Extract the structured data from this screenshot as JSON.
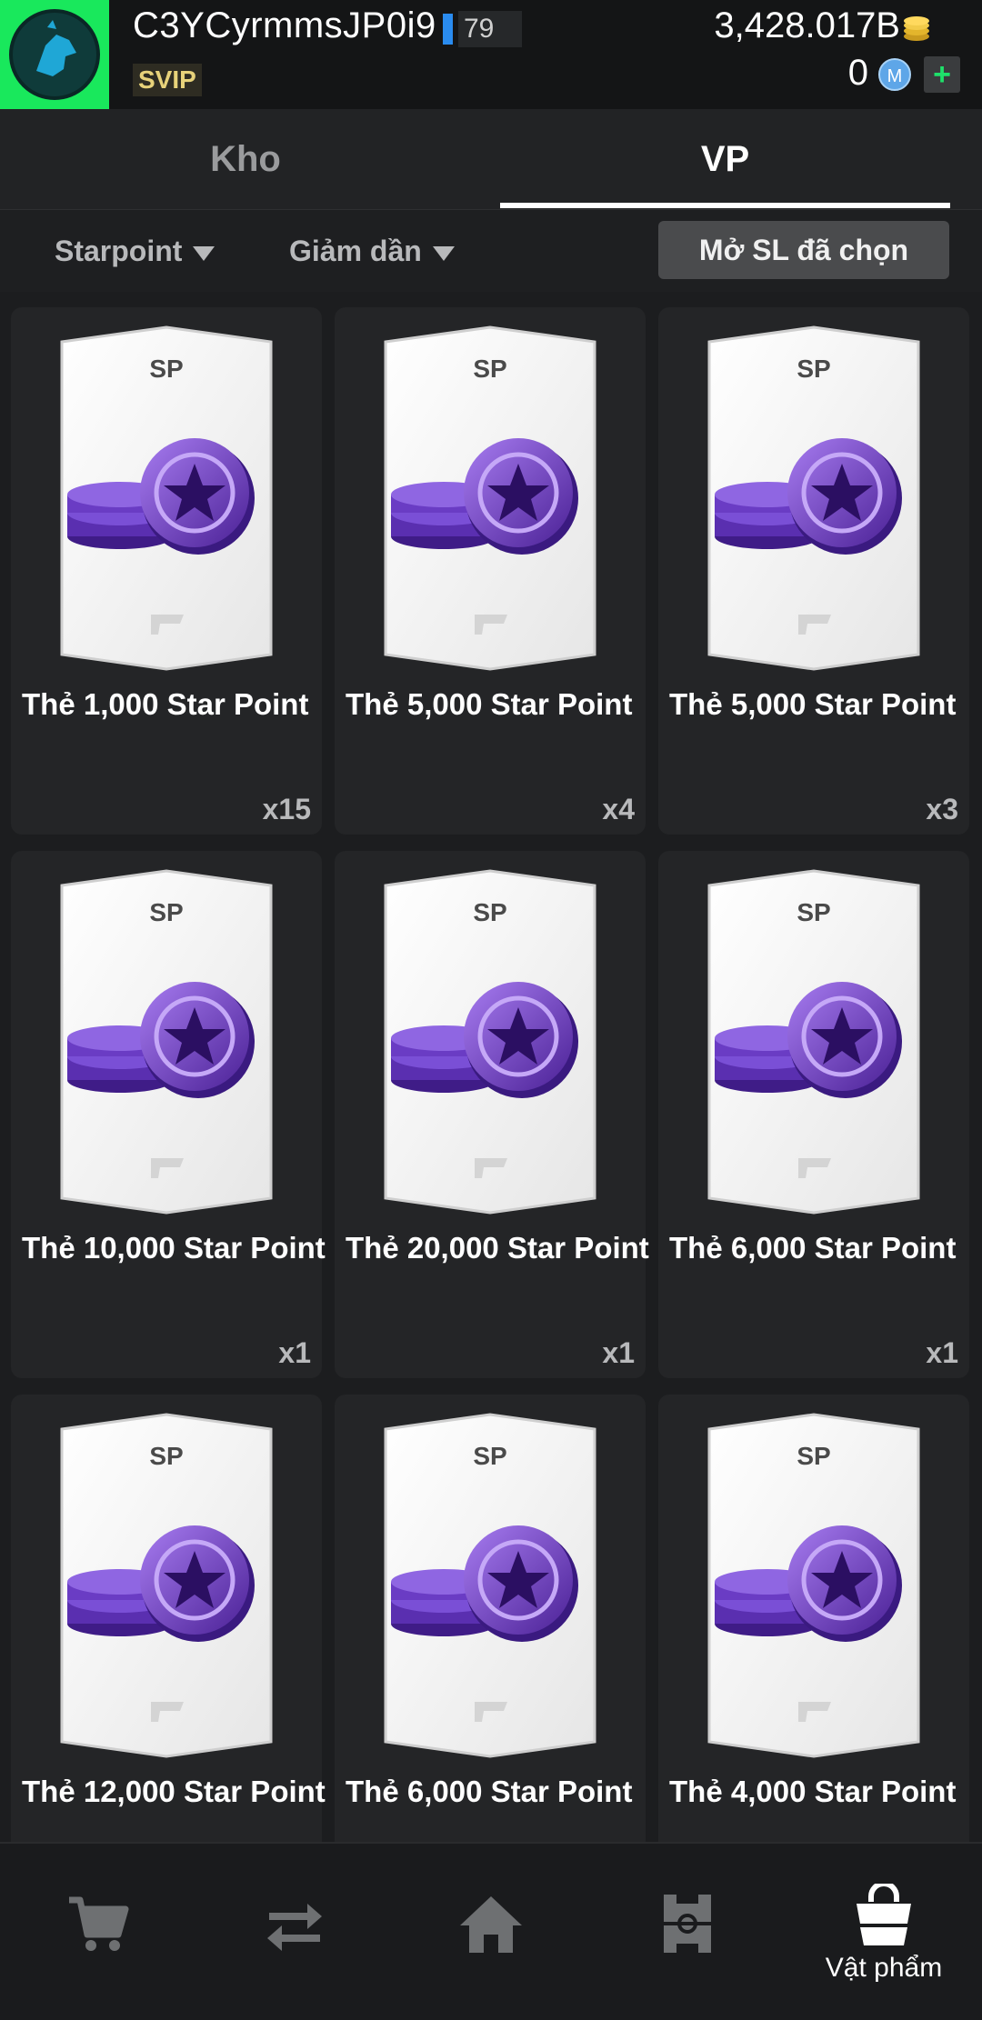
{
  "header": {
    "username": "C3YCyrmmsJP0i9",
    "level": "79",
    "vip_badge": "SVIP",
    "coins": "3,428.017B",
    "mp_count": "0",
    "mp_icon_letter": "M",
    "add_label": "+"
  },
  "tabs": [
    {
      "label": "Kho",
      "active": false
    },
    {
      "label": "VP",
      "active": true
    }
  ],
  "filters": {
    "sort_by": "Starpoint",
    "order": "Giảm dần",
    "open_selected_button": "Mở SL đã chọn"
  },
  "card_art_label": "SP",
  "items": [
    {
      "title": "Thẻ 1,000 Star Point",
      "qty": "x15"
    },
    {
      "title": "Thẻ 5,000 Star Point",
      "qty": "x4"
    },
    {
      "title": "Thẻ 5,000 Star Point",
      "qty": "x3"
    },
    {
      "title": "Thẻ 10,000 Star Point",
      "qty": "x1"
    },
    {
      "title": "Thẻ 20,000 Star Point",
      "qty": "x1"
    },
    {
      "title": "Thẻ 6,000 Star Point",
      "qty": "x1"
    },
    {
      "title": "Thẻ 12,000 Star Point",
      "qty": ""
    },
    {
      "title": "Thẻ 6,000 Star Point",
      "qty": ""
    },
    {
      "title": "Thẻ 4,000 Star Point",
      "qty": ""
    }
  ],
  "bottom_nav": [
    {
      "icon": "cart-icon",
      "label": "",
      "active": false
    },
    {
      "icon": "transfer-icon",
      "label": "",
      "active": false
    },
    {
      "icon": "home-icon",
      "label": "",
      "active": false
    },
    {
      "icon": "pitch-icon",
      "label": "",
      "active": false
    },
    {
      "icon": "shopping-bag-icon",
      "label": "Vật phẩm",
      "active": true
    }
  ],
  "colors": {
    "accent_green": "#19e85c",
    "level_blue": "#2a8cf0",
    "coin_purple": "#7a4fd6"
  }
}
